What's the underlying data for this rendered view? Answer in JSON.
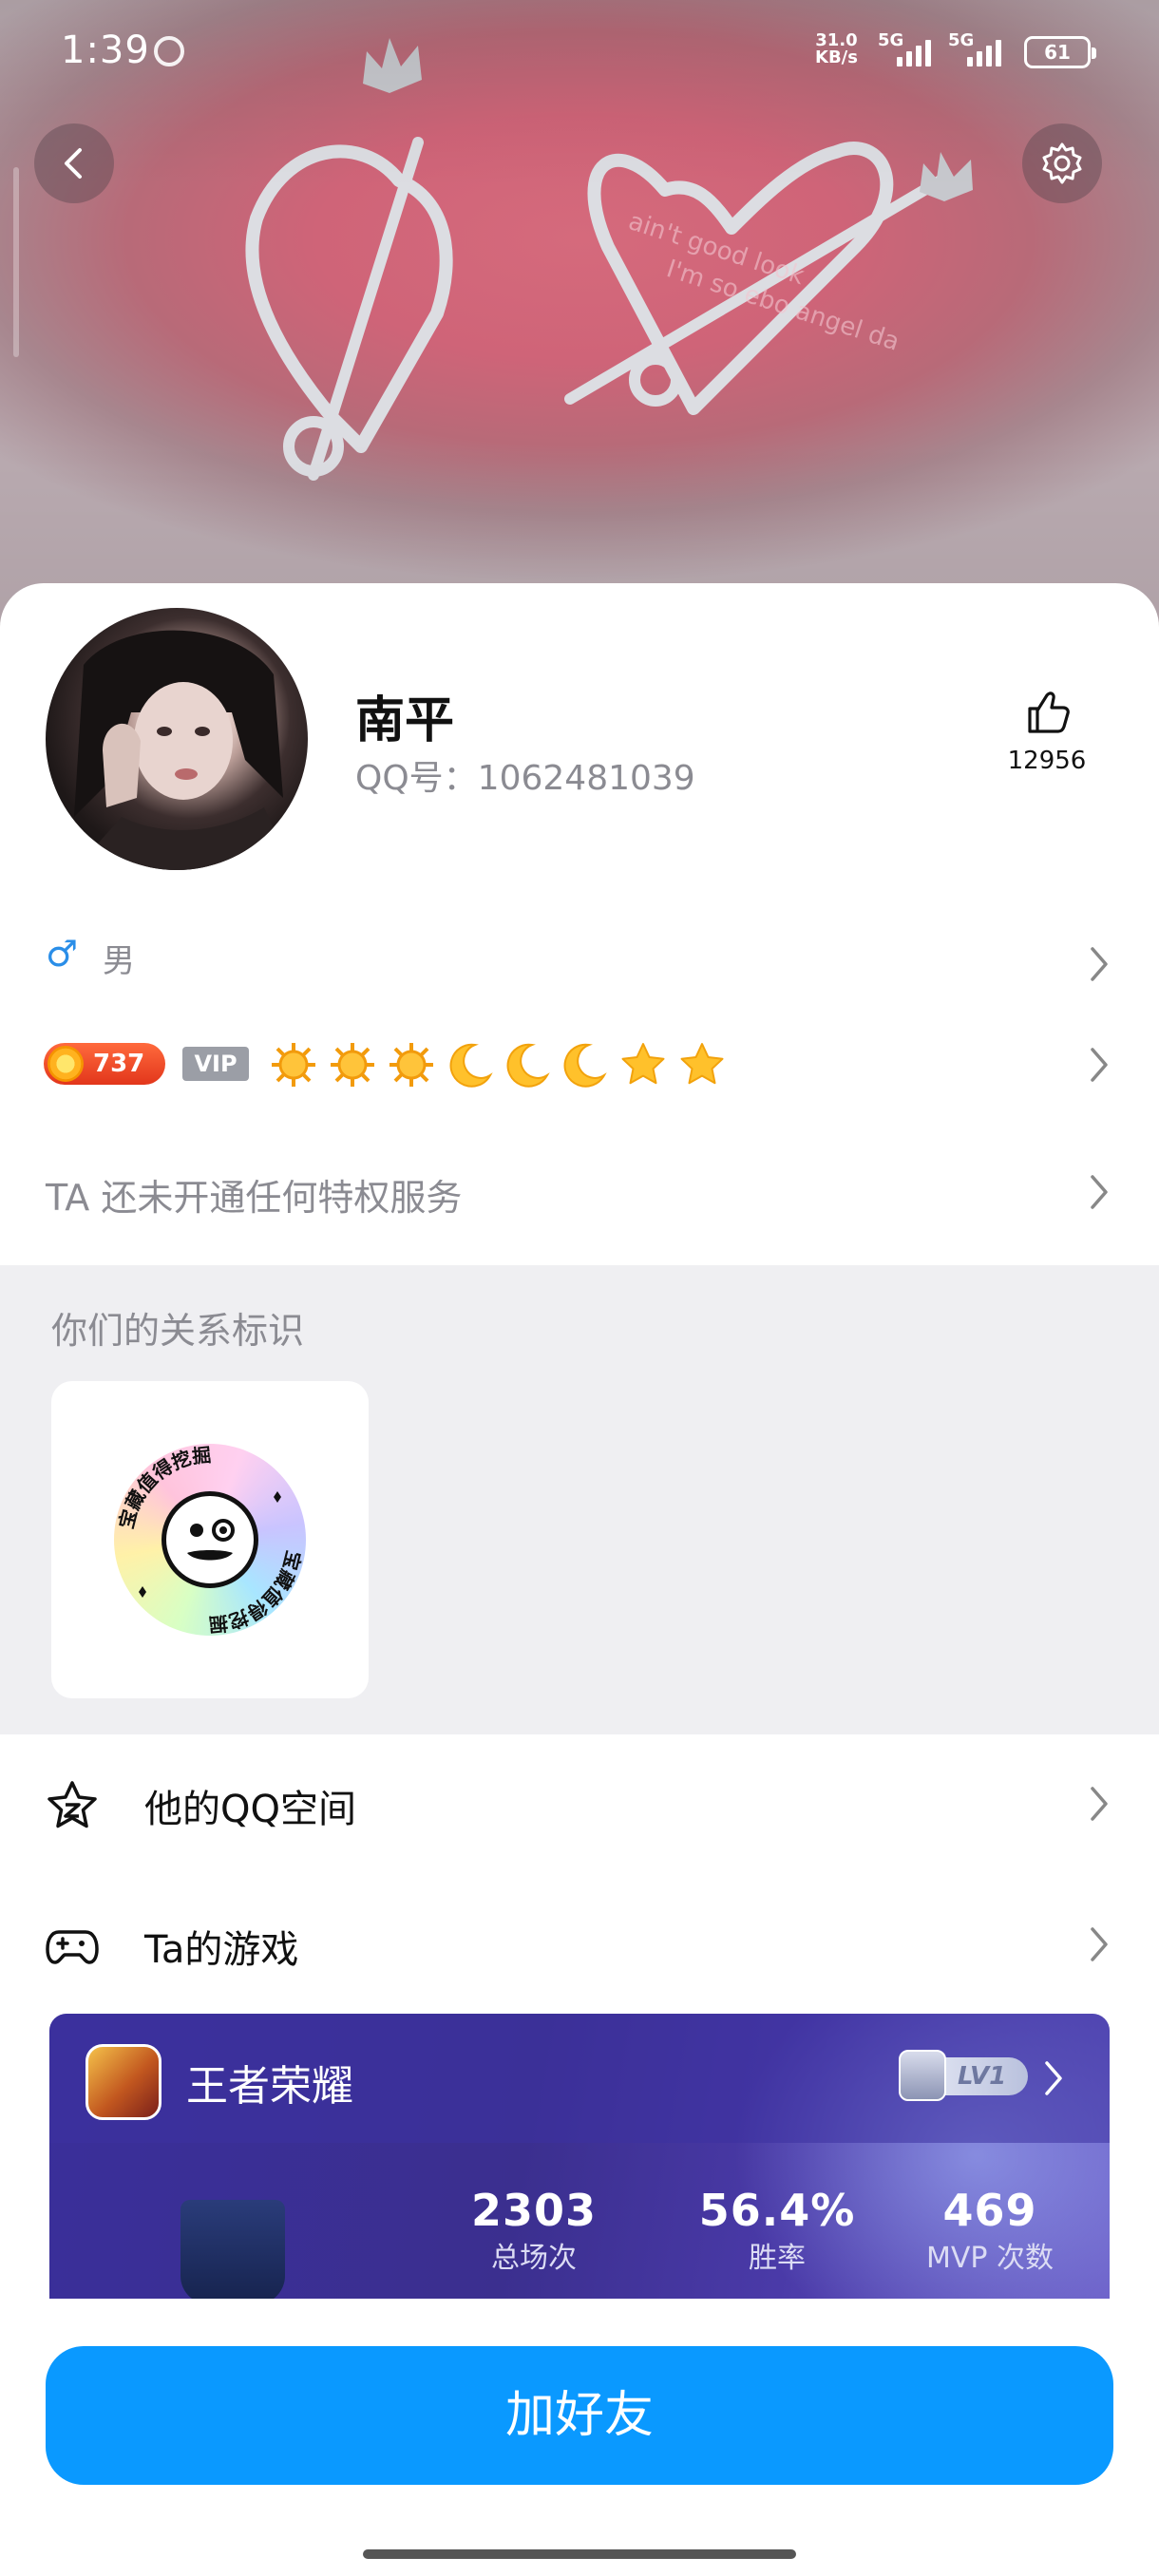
{
  "status_bar": {
    "time": "1:39",
    "net_speed_value": "31.0",
    "net_speed_unit": "KB/s",
    "signal1": "5G",
    "signal2": "5G",
    "battery": "61"
  },
  "profile": {
    "name": "南平",
    "qq_label": "QQ号：1062481039",
    "likes": "12956",
    "gender_symbol": "♂",
    "gender": "男",
    "coin_level": "737",
    "vip_label": "VIP",
    "level_icons": [
      "sun",
      "sun",
      "sun",
      "moon",
      "moon",
      "moon",
      "star",
      "star"
    ],
    "privilege_text": "TA 还未开通任何特权服务"
  },
  "relationship": {
    "title": "你们的关系标识",
    "badge_text": "宝藏值得挖掘"
  },
  "menu": {
    "qzone": "他的QQ空间",
    "games": "Ta的游戏"
  },
  "game_card": {
    "name": "王者荣耀",
    "level": "LV1",
    "stats": [
      {
        "value": "2303",
        "label": "总场次"
      },
      {
        "value": "56.4%",
        "label": "胜率"
      },
      {
        "value": "469",
        "label": "MVP 次数"
      }
    ]
  },
  "add_button": "加好友",
  "colors": {
    "accent": "#0A99FF",
    "gender_blue": "#2A8EE8",
    "coin_red": "#E2361B",
    "game_bg": "#3B2F8F"
  }
}
